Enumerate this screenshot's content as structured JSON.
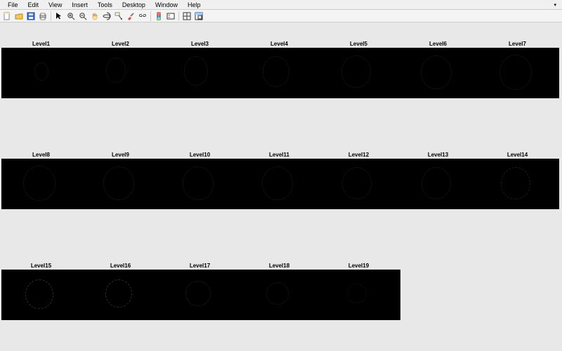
{
  "menu": {
    "file": "File",
    "edit": "Edit",
    "view": "View",
    "insert": "Insert",
    "tools": "Tools",
    "desktop": "Desktop",
    "window": "Window",
    "help": "Help"
  },
  "toolbar_icons": {
    "new": "new-file-icon",
    "open": "open-folder-icon",
    "save": "save-icon",
    "print": "print-icon",
    "pointer": "pointer-icon",
    "zoom_in": "zoom-in-icon",
    "zoom_out": "zoom-out-icon",
    "pan": "pan-hand-icon",
    "rotate": "rotate-3d-icon",
    "data_cursor": "data-cursor-icon",
    "brush": "brush-icon",
    "link": "link-icon",
    "colorbar": "colorbar-icon",
    "legend": "legend-icon",
    "subplot": "subplot-grid-icon",
    "dock": "dock-figure-icon"
  },
  "rows": [
    {
      "top_titles": 58,
      "top_strip": 68,
      "strip_width": 794,
      "titles": [
        "Level1",
        "Level2",
        "Level3",
        "Level4",
        "Level5",
        "Level6",
        "Level7"
      ],
      "cells": 7
    },
    {
      "top_titles": 216,
      "top_strip": 226,
      "strip_width": 794,
      "titles": [
        "Level8",
        "Level9",
        "Level10",
        "Level11",
        "Level12",
        "Level13",
        "Level14"
      ],
      "cells": 7
    },
    {
      "top_titles": 374,
      "top_strip": 384,
      "strip_width": 568,
      "titles": [
        "Level15",
        "Level16",
        "Level17",
        "Level18",
        "Level19"
      ],
      "cells": 5
    }
  ]
}
